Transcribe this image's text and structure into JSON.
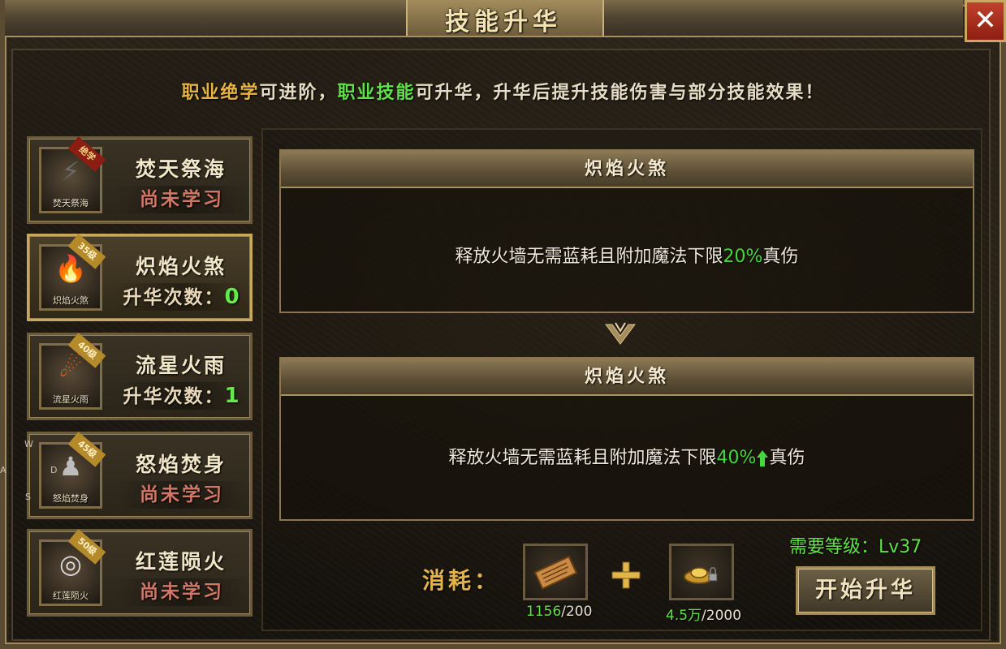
{
  "window": {
    "title": "技能升华",
    "close_symbol": "✕"
  },
  "notice": {
    "part1_gold": "职业绝学",
    "part2": "可进阶，",
    "part3_green": "职业技能",
    "part4": "可升华，升华后提升技能伤害与部分技能效果！"
  },
  "skills": [
    {
      "name": "焚天祭海",
      "icon_name": "焚天祭海",
      "icon": "scroll-icon",
      "badge": "绝学",
      "status": "尚未学习",
      "upgrade_count": null
    },
    {
      "name": "炽焰火煞",
      "icon_name": "炽焰火煞",
      "icon": "flame-icon",
      "badge": "35级",
      "status": "升华次数：",
      "upgrade_count": "0"
    },
    {
      "name": "流星火雨",
      "icon_name": "流星火雨",
      "icon": "meteor-icon",
      "badge": "40级",
      "status": "升华次数：",
      "upgrade_count": "1"
    },
    {
      "name": "怒焰焚身",
      "icon_name": "怒焰焚身",
      "icon": "figure-icon",
      "badge": "45级",
      "status": "尚未学习",
      "upgrade_count": null
    },
    {
      "name": "红莲陨火",
      "icon_name": "红莲陨火",
      "icon": "swirl-icon",
      "badge": "50级",
      "status": "尚未学习",
      "upgrade_count": null
    }
  ],
  "wasd": {
    "w": "W",
    "a": "A",
    "d": "D",
    "s": "S"
  },
  "current": {
    "title": "炽焰火煞",
    "desc_before": "释放火墙无需蓝耗且附加魔法下限",
    "pct": "20%",
    "desc_after": "真伤"
  },
  "next": {
    "title": "炽焰火煞",
    "desc_before": "释放火墙无需蓝耗且附加魔法下限",
    "pct": "40%",
    "desc_after": "真伤"
  },
  "requirement": "需要等级：Lv37",
  "cost": {
    "label": "消耗：",
    "items": [
      {
        "icon": "scroll-icon",
        "have": "1156",
        "need": "/200"
      },
      {
        "icon": "gold-ingot-icon",
        "have": "4.5万",
        "need": "/2000"
      }
    ]
  },
  "start_button": "开始升华",
  "colors": {
    "green": "#5fe247",
    "gold": "#e7b341",
    "close_red": "#c1412c"
  }
}
